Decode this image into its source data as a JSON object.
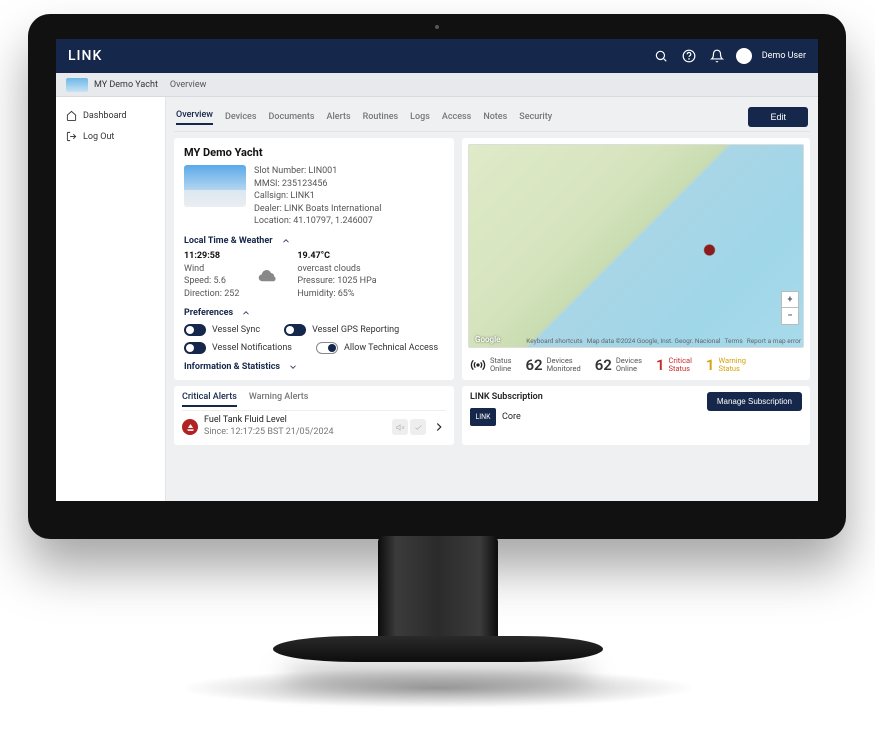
{
  "brand": "LINK",
  "user": {
    "name": "Demo User"
  },
  "breadcrumb": {
    "vessel": "MY Demo Yacht",
    "page": "Overview"
  },
  "sidebar": {
    "items": [
      {
        "label": "Dashboard",
        "key": "dashboard"
      },
      {
        "label": "Log Out",
        "key": "logout"
      }
    ]
  },
  "tabs": [
    "Overview",
    "Devices",
    "Documents",
    "Alerts",
    "Routines",
    "Logs",
    "Access",
    "Notes",
    "Security"
  ],
  "edit_label": "Edit",
  "vessel": {
    "name": "MY Demo Yacht",
    "slot_label": "Slot Number:",
    "slot": "LIN001",
    "mmsi_label": "MMSI:",
    "mmsi": "235123456",
    "callsign_label": "Callsign:",
    "callsign": "LINK1",
    "dealer_label": "Dealer:",
    "dealer": "LINK Boats International",
    "location_label": "Location:",
    "location": "41.10797, 1.246007"
  },
  "weather_hdr": "Local Time & Weather",
  "weather": {
    "time": "11:29:58",
    "wind_label": "Wind",
    "speed_label": "Speed:",
    "speed": "5.6",
    "dir_label": "Direction:",
    "dir": "252",
    "temp": "19.47°C",
    "desc": "overcast clouds",
    "press_label": "Pressure:",
    "press": "1025 HPa",
    "hum_label": "Humidity:",
    "hum": "65%"
  },
  "prefs_hdr": "Preferences",
  "prefs": [
    {
      "label": "Vessel Sync",
      "state": "on"
    },
    {
      "label": "Vessel GPS Reporting",
      "state": "on"
    },
    {
      "label": "Vessel Notifications",
      "state": "on"
    },
    {
      "label": "Allow Technical Access",
      "state": "off"
    }
  ],
  "info_hdr": "Information & Statistics",
  "map": {
    "google": "Google",
    "shortcuts": "Keyboard shortcuts",
    "attrib": "Map data ©2024 Google, Inst. Geogr. Nacional",
    "terms": "Terms",
    "report": "Report a map error"
  },
  "stats": {
    "status_label": "Status",
    "status_value": "Online",
    "monitored_value": "62",
    "monitored_label": "Devices\nMonitored",
    "online_value": "62",
    "online_label": "Devices\nOnline",
    "critical_value": "1",
    "critical_label": "Critical\nStatus",
    "warning_value": "1",
    "warning_label": "Warning\nStatus"
  },
  "alerts": {
    "tab_critical": "Critical Alerts",
    "tab_warning": "Warning Alerts",
    "item_title": "Fuel Tank Fluid Level",
    "item_since_label": "Since:",
    "item_since": "12:17:25 BST 21/05/2024"
  },
  "subscription": {
    "header": "LINK Subscription",
    "badge": "LINK",
    "plan": "Core",
    "manage": "Manage Subscription"
  }
}
